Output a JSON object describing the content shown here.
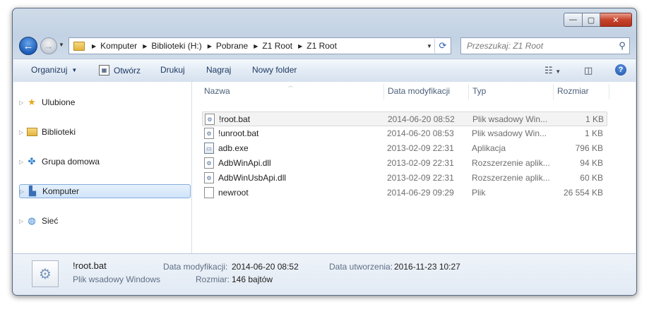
{
  "window": {
    "buttons": {
      "minimize": "—",
      "maximize": "▢",
      "close": "✕"
    }
  },
  "address": {
    "crumbs": [
      "Komputer",
      "Biblioteki (H:)",
      "Pobrane",
      "Z1 Root",
      "Z1 Root"
    ]
  },
  "search": {
    "placeholder": "Przeszukaj: Z1 Root"
  },
  "toolbar": {
    "organize": "Organizuj",
    "open": "Otwórz",
    "print": "Drukuj",
    "burn": "Nagraj",
    "new_folder": "Nowy folder",
    "help": "?"
  },
  "nav": {
    "items": [
      {
        "label": "Ulubione",
        "icon": "star-icon"
      },
      {
        "label": "Biblioteki",
        "icon": "library-icon"
      },
      {
        "label": "Grupa domowa",
        "icon": "homegroup-icon"
      },
      {
        "label": "Komputer",
        "icon": "computer-icon",
        "selected": true
      },
      {
        "label": "Sieć",
        "icon": "network-icon"
      }
    ]
  },
  "columns": {
    "name": "Nazwa",
    "date": "Data modyfikacji",
    "type": "Typ",
    "size": "Rozmiar"
  },
  "files": [
    {
      "name": "!root.bat",
      "date": "2014-06-20 08:52",
      "type": "Plik wsadowy Win...",
      "size": "1 KB",
      "icon": "batch-file-icon",
      "highlighted": true
    },
    {
      "name": "!unroot.bat",
      "date": "2014-06-20 08:53",
      "type": "Plik wsadowy Win...",
      "size": "1 KB",
      "icon": "batch-file-icon"
    },
    {
      "name": "adb.exe",
      "date": "2013-02-09 22:31",
      "type": "Aplikacja",
      "size": "796 KB",
      "icon": "exe-file-icon"
    },
    {
      "name": "AdbWinApi.dll",
      "date": "2013-02-09 22:31",
      "type": "Rozszerzenie aplik...",
      "size": "94 KB",
      "icon": "dll-file-icon"
    },
    {
      "name": "AdbWinUsbApi.dll",
      "date": "2013-02-09 22:31",
      "type": "Rozszerzenie aplik...",
      "size": "60 KB",
      "icon": "dll-file-icon"
    },
    {
      "name": "newroot",
      "date": "2014-06-29 09:29",
      "type": "Plik",
      "size": "26 554 KB",
      "icon": "generic-file-icon"
    }
  ],
  "details": {
    "name": "!root.bat",
    "type": "Plik wsadowy Windows",
    "modified_label": "Data modyfikacji:",
    "modified_value": "2014-06-20 08:52",
    "created_label": "Data utworzenia:",
    "created_value": "2016-11-23 10:27",
    "size_label": "Rozmiar:",
    "size_value": "146 bajtów"
  }
}
